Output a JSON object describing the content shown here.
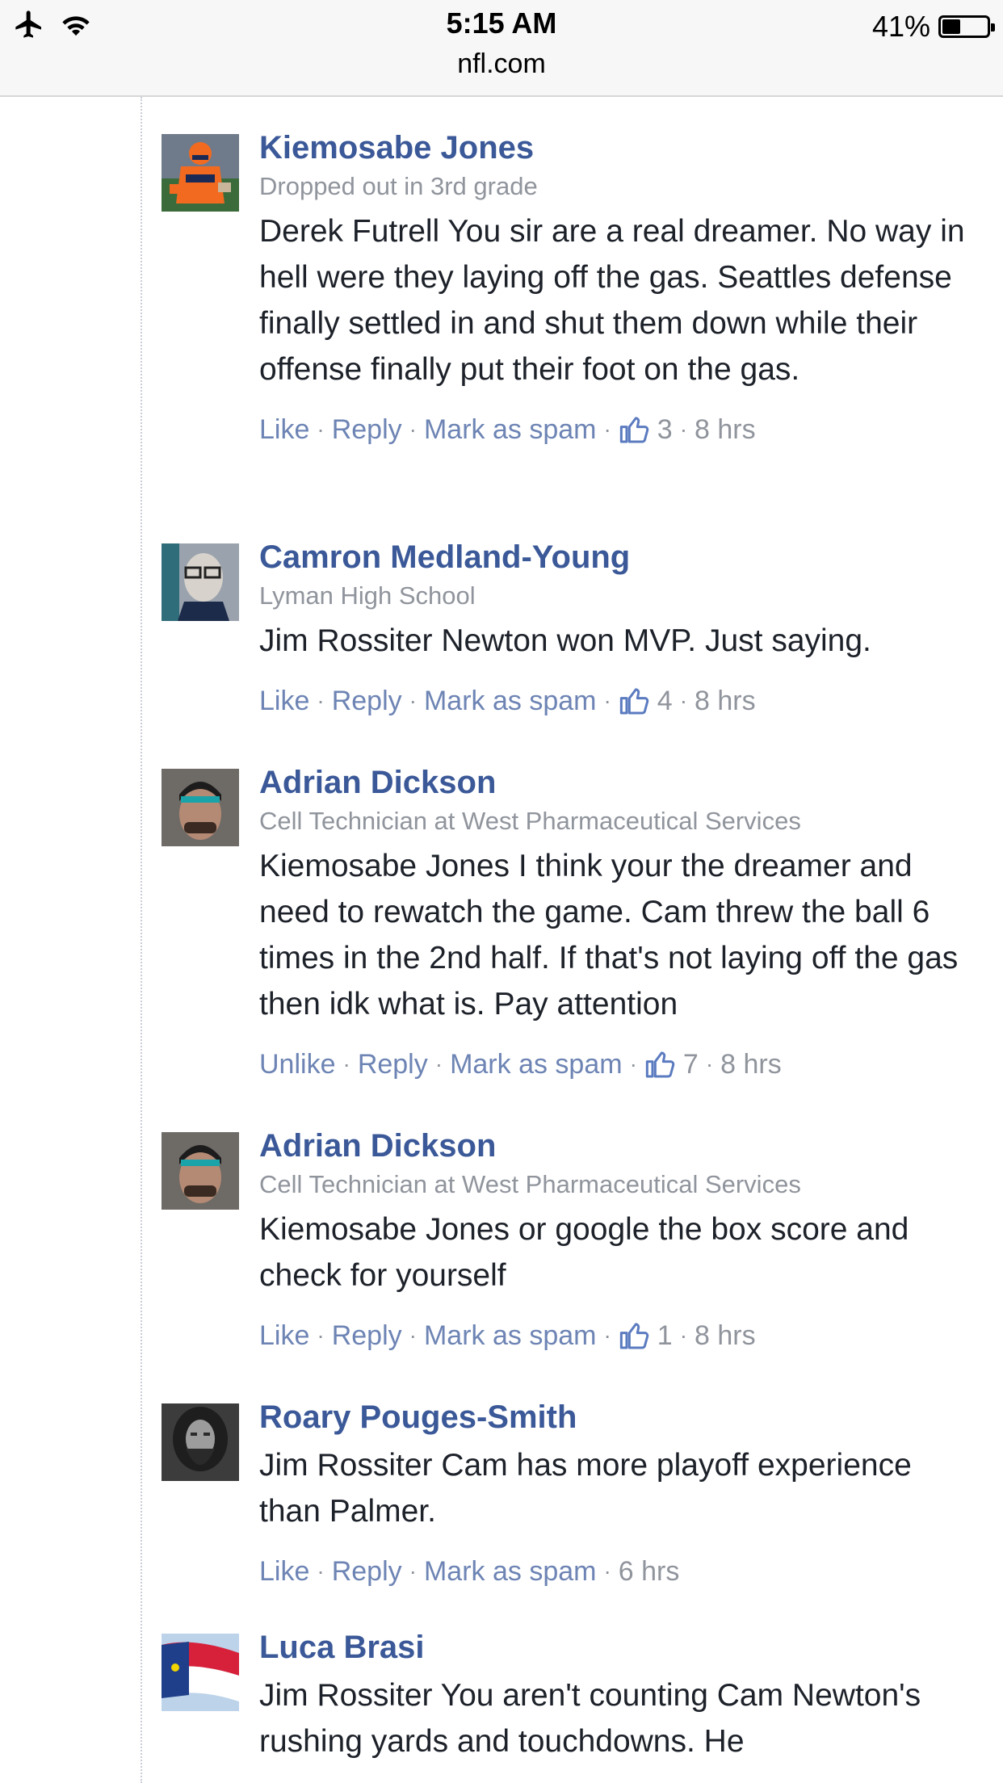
{
  "status_bar": {
    "time": "5:15 AM",
    "url": "nfl.com",
    "battery": "41%",
    "battery_level": 0.41
  },
  "actions_labels": {
    "like": "Like",
    "unlike": "Unlike",
    "reply": "Reply",
    "spam": "Mark as spam"
  },
  "comments": [
    {
      "author": "Kiemosabe Jones",
      "subtitle": "Dropped out in 3rd grade",
      "text": "Derek Futrell You sir are a real dreamer. No way in hell were they laying off the gas. Seattles defense finally settled in and shut them down while their offense finally put their foot on the gas.",
      "like_label": "Like",
      "likes": "3",
      "time": "8 hrs",
      "avatar": "football-player-avatar"
    },
    {
      "author": "Camron Medland-Young",
      "subtitle": "Lyman High School",
      "text": "Jim Rossiter Newton won MVP. Just saying.",
      "like_label": "Like",
      "likes": "4",
      "time": "8 hrs",
      "avatar": "glasses-person-avatar"
    },
    {
      "author": "Adrian Dickson",
      "subtitle": "Cell Technician at West Pharmaceutical Services",
      "text": "Kiemosabe Jones I think your the dreamer and need to rewatch the game. Cam threw the ball 6 times in the 2nd half. If that's not laying off the gas then idk what is. Pay attention",
      "like_label": "Unlike",
      "likes": "7",
      "time": "8 hrs",
      "avatar": "headband-man-avatar"
    },
    {
      "author": "Adrian Dickson",
      "subtitle": "Cell Technician at West Pharmaceutical Services",
      "text": "Kiemosabe Jones or google the box score and check for yourself",
      "like_label": "Like",
      "likes": "1",
      "time": "8 hrs",
      "avatar": "headband-man-avatar"
    },
    {
      "author": "Roary Pouges-Smith",
      "subtitle": "",
      "text": "Jim Rossiter Cam has more playoff experience than Palmer.",
      "like_label": "Like",
      "likes": "",
      "time": "6 hrs",
      "avatar": "bearded-face-avatar"
    },
    {
      "author": "Luca Brasi",
      "subtitle": "",
      "text": "Jim Rossiter You aren't counting Cam Newton's rushing yards and touchdowns. He",
      "like_label": "Like",
      "likes": "",
      "time": "",
      "avatar": "nc-flag-avatar"
    }
  ]
}
